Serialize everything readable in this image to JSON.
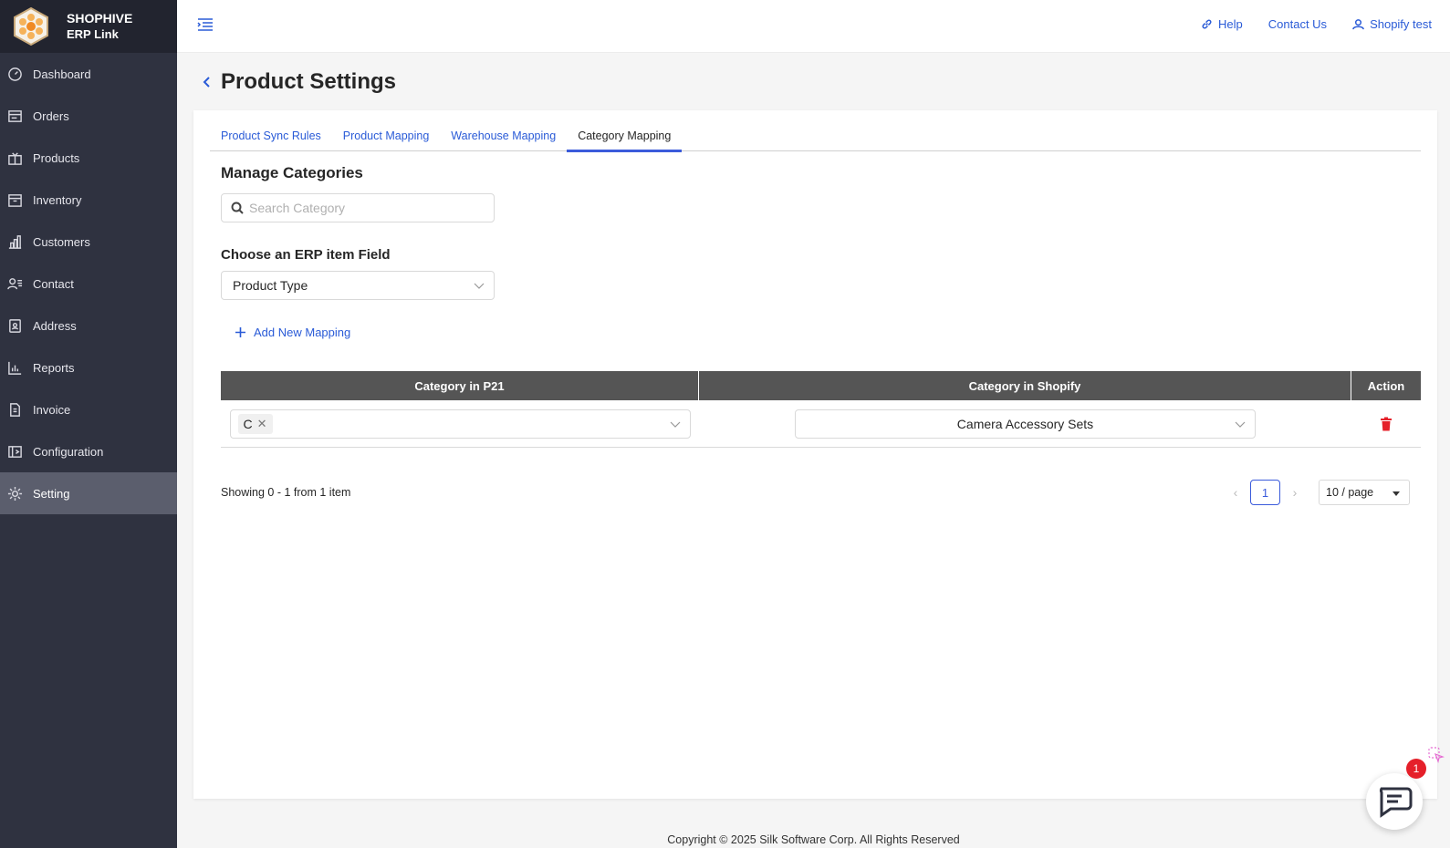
{
  "brand": {
    "name": "SHOPHIVE",
    "sub": "ERP Link"
  },
  "sidebar": {
    "items": [
      {
        "label": "Dashboard",
        "icon": "dashboard-icon"
      },
      {
        "label": "Orders",
        "icon": "orders-icon"
      },
      {
        "label": "Products",
        "icon": "products-icon"
      },
      {
        "label": "Inventory",
        "icon": "inventory-icon"
      },
      {
        "label": "Customers",
        "icon": "customers-icon"
      },
      {
        "label": "Contact",
        "icon": "contact-icon"
      },
      {
        "label": "Address",
        "icon": "address-icon"
      },
      {
        "label": "Reports",
        "icon": "reports-icon"
      },
      {
        "label": "Invoice",
        "icon": "invoice-icon"
      },
      {
        "label": "Configuration",
        "icon": "configuration-icon"
      },
      {
        "label": "Setting",
        "icon": "gear-icon",
        "active": true
      }
    ]
  },
  "header": {
    "help": "Help",
    "contact": "Contact Us",
    "user": "Shopify test"
  },
  "page": {
    "title": "Product Settings"
  },
  "tabs": [
    {
      "label": "Product Sync Rules"
    },
    {
      "label": "Product Mapping"
    },
    {
      "label": "Warehouse Mapping"
    },
    {
      "label": "Category Mapping",
      "active": true
    }
  ],
  "manage": {
    "title": "Manage Categories",
    "search_placeholder": "Search Category",
    "field_label": "Choose an ERP item Field",
    "field_value": "Product Type",
    "add_mapping": "Add New Mapping"
  },
  "table": {
    "columns": [
      "Category in P21",
      "Category in Shopify",
      "Action"
    ],
    "rows": [
      {
        "p21_tags": [
          "C"
        ],
        "shopify": "Camera Accessory Sets"
      }
    ]
  },
  "pagination": {
    "showing": "Showing 0 - 1 from 1 item",
    "current_page": "1",
    "page_size": "10 / page"
  },
  "footer": {
    "copyright": "Copyright © 2025 Silk Software Corp. All Rights Reserved"
  },
  "chat": {
    "badge": "1"
  },
  "colors": {
    "sidebar": "#2f3240",
    "accent": "#2a5bd7",
    "danger": "#e5202a"
  }
}
